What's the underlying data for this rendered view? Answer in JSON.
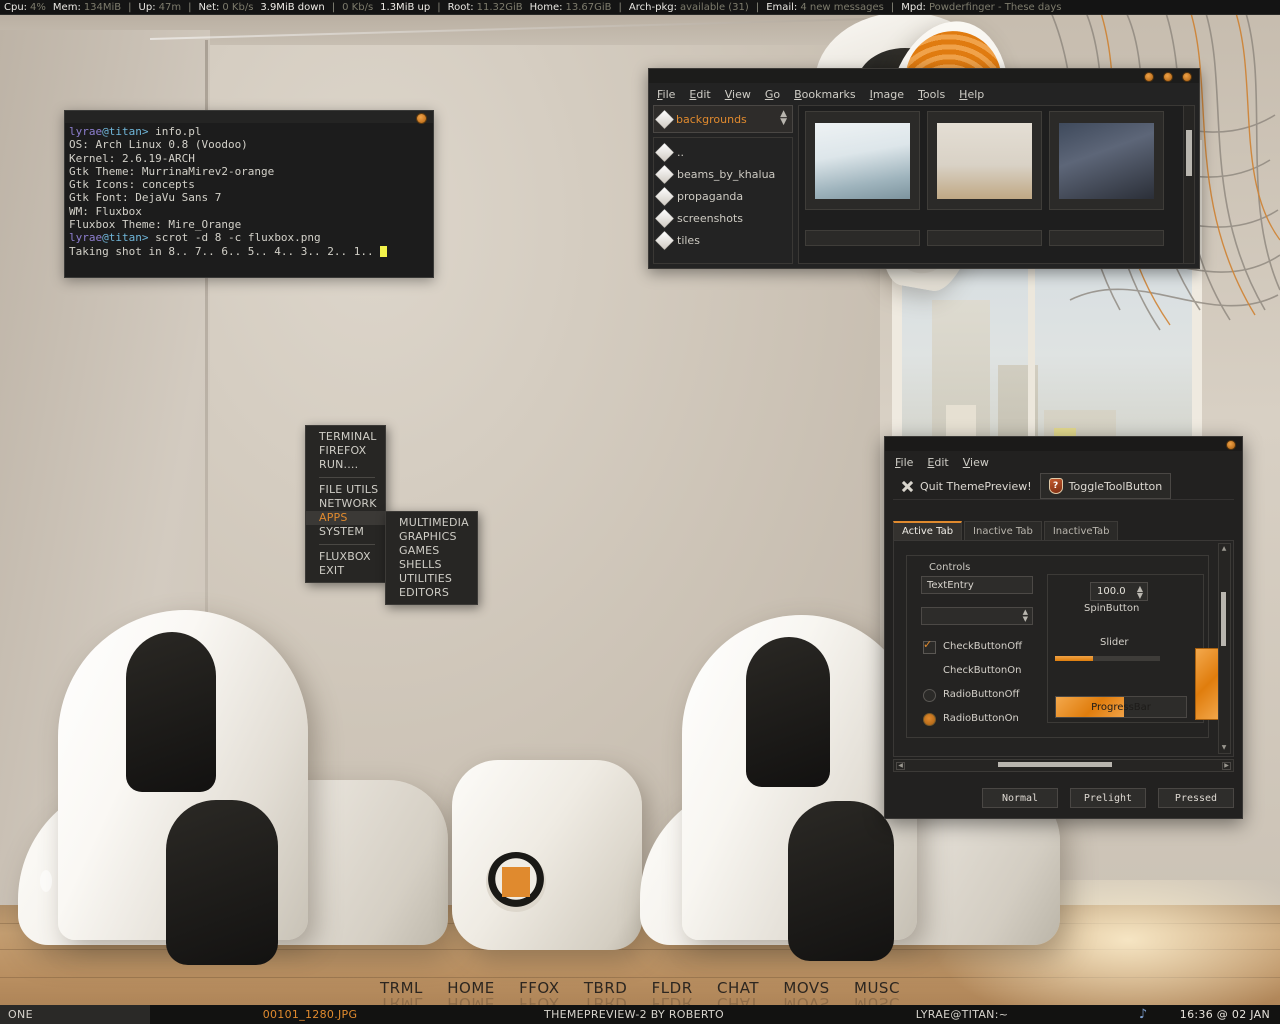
{
  "topbar": {
    "items": [
      {
        "label": "Cpu:",
        "value": "4%",
        "bright": false
      },
      {
        "label": "Mem:",
        "value": "134MiB",
        "bright": false
      },
      {
        "sep": "|"
      },
      {
        "label": "Up:",
        "value": "47m",
        "bright": false
      },
      {
        "sep": "|"
      },
      {
        "label": "Net:",
        "value": "0 Kb/s",
        "bright": false
      },
      {
        "label": "",
        "value": "3.9MiB down",
        "bright": true
      },
      {
        "sep": "|"
      },
      {
        "label": "",
        "value": "0 Kb/s",
        "bright": false
      },
      {
        "label": "",
        "value": "1.3MiB up",
        "bright": true
      },
      {
        "sep": "|"
      },
      {
        "label": "Root:",
        "value": "11.32GiB",
        "bright": false
      },
      {
        "label": "Home:",
        "value": "13.67GiB",
        "bright": false
      },
      {
        "sep": "|"
      },
      {
        "label": "Arch-pkg:",
        "value": "available (31)",
        "bright": false
      },
      {
        "sep": "|"
      },
      {
        "label": "Email:",
        "value": "4 new messages",
        "bright": false
      },
      {
        "sep": "|"
      },
      {
        "label": "Mpd:",
        "value": "Powderfinger - These days",
        "bright": false
      }
    ]
  },
  "terminal": {
    "title_button": "minimize-dot",
    "lines": [
      {
        "prompt": "lyrae@titan>",
        "text": " info.pl"
      },
      {
        "prompt": "",
        "text": "OS: Arch Linux 0.8 (Voodoo)"
      },
      {
        "prompt": "",
        "text": "Kernel: 2.6.19-ARCH"
      },
      {
        "prompt": "",
        "text": "Gtk Theme: MurrinaMirev2-orange"
      },
      {
        "prompt": "",
        "text": "Gtk Icons: concepts"
      },
      {
        "prompt": "",
        "text": "Gtk Font: DejaVu Sans 7"
      },
      {
        "prompt": "",
        "text": "WM: Fluxbox"
      },
      {
        "prompt": "",
        "text": "Fluxbox Theme: Mire_Orange"
      },
      {
        "prompt": "lyrae@titan>",
        "text": " scrot -d 8 -c fluxbox.png"
      },
      {
        "prompt": "",
        "text": "Taking shot in 8.. 7.. 6.. 5.. 4.. 3.. 2.. 1.. "
      }
    ]
  },
  "filemanager": {
    "menu": [
      "File",
      "Edit",
      "View",
      "Go",
      "Bookmarks",
      "Image",
      "Tools",
      "Help"
    ],
    "path_combo": {
      "value": "backgrounds",
      "icon": "gem-icon"
    },
    "folders": [
      "..",
      "beams_by_khalua",
      "propaganda",
      "screenshots",
      "tiles"
    ],
    "thumbnails": [
      {
        "name": "thumb-seascape"
      },
      {
        "name": "thumb-room-chairs"
      },
      {
        "name": "thumb-crows"
      }
    ]
  },
  "rootmenu": {
    "items": [
      {
        "label": "TERMINAL",
        "selected": false
      },
      {
        "label": "FIREFOX",
        "selected": false
      },
      {
        "label": "RUN....",
        "selected": false
      },
      {
        "separator": true
      },
      {
        "label": "FILE UTILS",
        "selected": false
      },
      {
        "label": "NETWORK",
        "selected": false
      },
      {
        "label": "APPS",
        "selected": true
      },
      {
        "label": "SYSTEM",
        "selected": false
      },
      {
        "separator": true
      },
      {
        "label": "FLUXBOX",
        "selected": false
      },
      {
        "label": "EXIT",
        "selected": false
      }
    ],
    "submenu": [
      "MULTIMEDIA",
      "GRAPHICS",
      "GAMES",
      "SHELLS",
      "UTILITIES",
      "EDITORS"
    ]
  },
  "themepreview": {
    "menu": [
      "File",
      "Edit",
      "View"
    ],
    "toolbar": [
      {
        "label": "Quit ThemePreview!",
        "icon": "close-x-icon"
      },
      {
        "label": "ToggleToolButton",
        "icon": "help-shield-icon"
      }
    ],
    "tabs": [
      {
        "label": "Active Tab",
        "active": true
      },
      {
        "label": "Inactive Tab",
        "active": false
      },
      {
        "label": "InactiveTab",
        "active": false
      }
    ],
    "frame_label": "Controls",
    "text_entry": {
      "value": "TextEntry"
    },
    "combo": {
      "value": ""
    },
    "checks": [
      {
        "label": "CheckButtonOff",
        "checked": false
      },
      {
        "label": "CheckButtonOn",
        "checked": true
      }
    ],
    "radios": [
      {
        "label": "RadioButtonOff",
        "checked": false
      },
      {
        "label": "RadioButtonOn",
        "checked": true
      }
    ],
    "spin": {
      "value": "100.0",
      "label": "SpinButton"
    },
    "slider": {
      "label": "Slider",
      "percent": 36
    },
    "progress": {
      "label": "ProgressBar",
      "percent": 52
    },
    "buttons": [
      "Normal",
      "Prelight",
      "Pressed"
    ]
  },
  "dock": {
    "items": [
      "TRML",
      "HOME",
      "FFOX",
      "TBRD",
      "FLDR",
      "CHAT",
      "MOVS",
      "MUSC"
    ]
  },
  "bottombar": {
    "workspace": "ONE",
    "iconified": "00101_1280.JPG",
    "window_title": "THEMEPREVIEW-2 BY ROBERTO",
    "focused": "LYRAE@TITAN:~",
    "note_icon": "music-note-icon",
    "clock": "16:36 @ 02 JAN"
  },
  "colors": {
    "accent": "#e08a2e",
    "panel": "#141414",
    "window": "#232323"
  }
}
